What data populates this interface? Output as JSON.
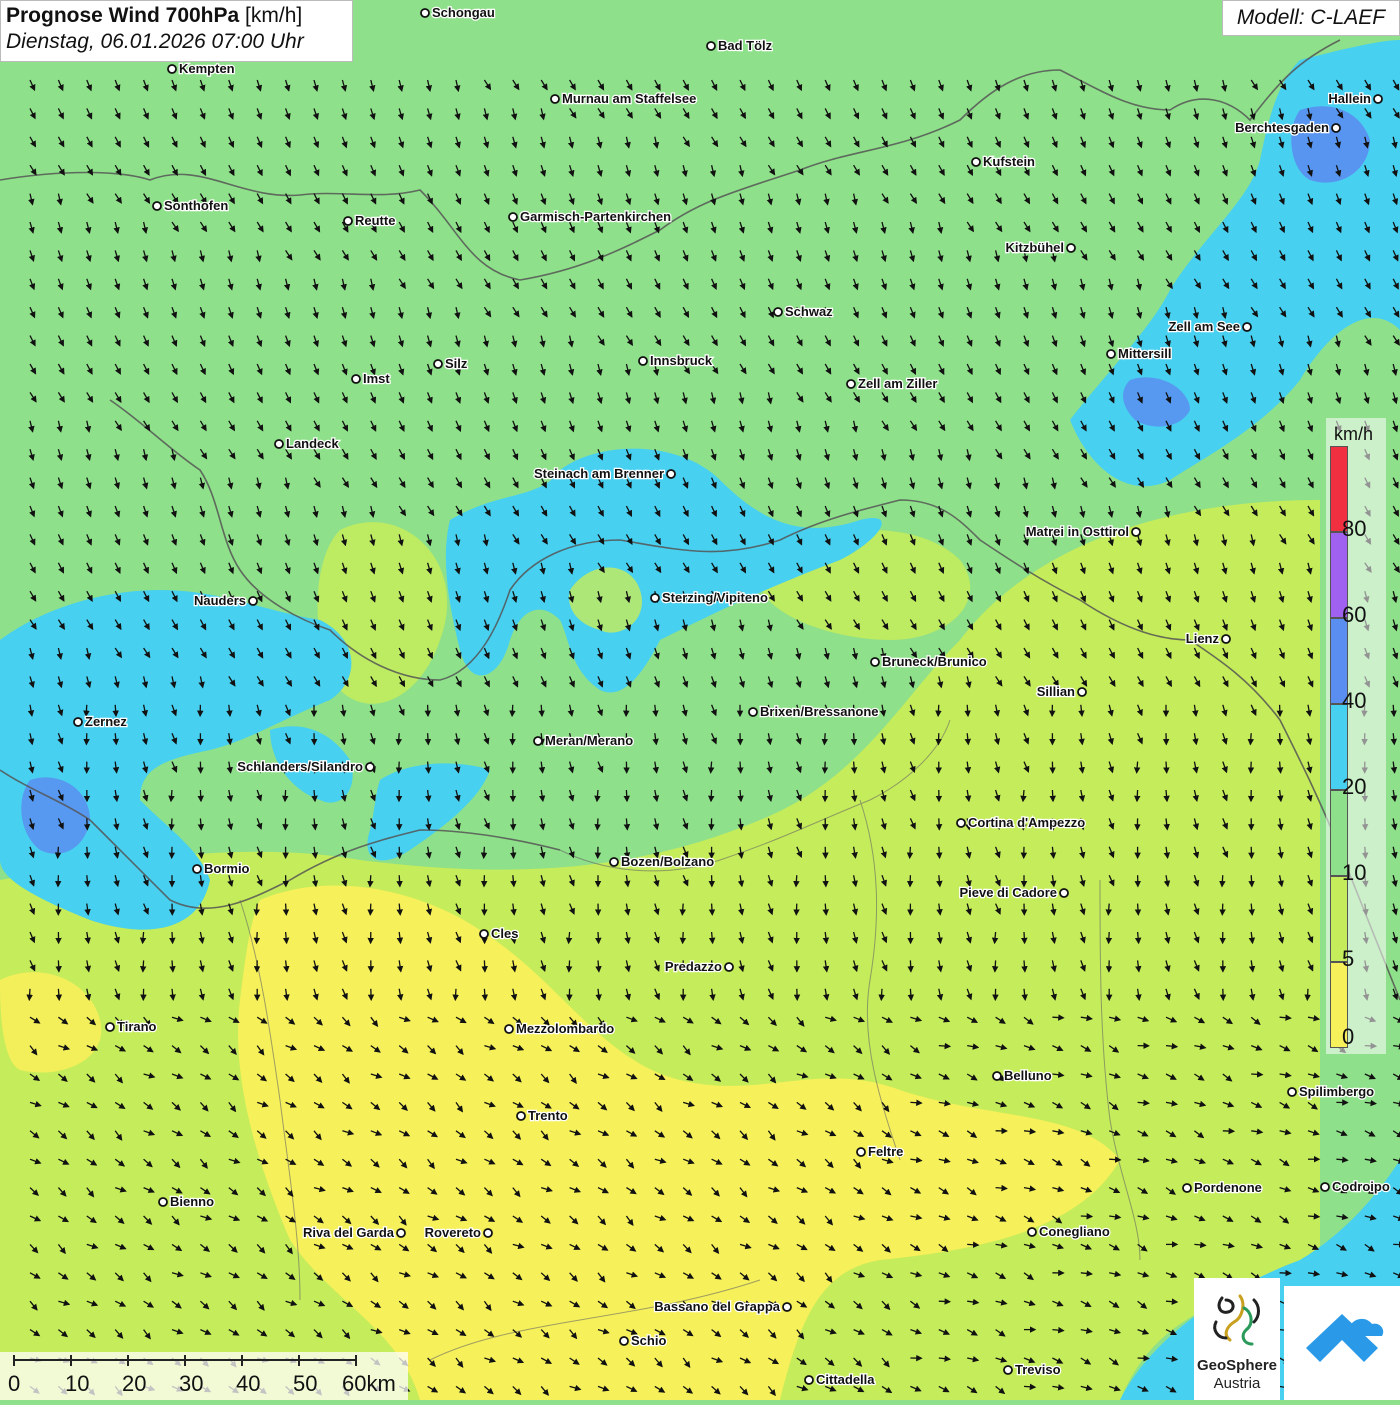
{
  "title": {
    "bold": "Prognose Wind 700hPa",
    "unit": "[km/h]",
    "datetime": "Dienstag, 06.01.2026 07:00 Uhr"
  },
  "model": "Modell: C-LAEF",
  "legend": {
    "unit": "km/h",
    "ticks": [
      "0",
      "5",
      "10",
      "20",
      "40",
      "60",
      "80"
    ],
    "colors": [
      "#f6f05a",
      "#c5ec5a",
      "#8fe08a",
      "#48d0f0",
      "#5a8ef0",
      "#a060f0",
      "#f03040"
    ]
  },
  "scale": {
    "labels": [
      "0",
      "10",
      "20",
      "30",
      "40",
      "50",
      "60km"
    ]
  },
  "logo": {
    "name": "GeoSphere",
    "sub": "Austria"
  },
  "icons": [
    "geosphere-logo-icon",
    "weather-app-icon"
  ],
  "cities": [
    {
      "name": "Schongau"
    },
    {
      "name": "Bad Tölz"
    },
    {
      "name": "Kempten"
    },
    {
      "name": "Murnau am Staffelsee"
    },
    {
      "name": "Hallein"
    },
    {
      "name": "Berchtesgaden"
    },
    {
      "name": "Kufstein"
    },
    {
      "name": "Sonthofen"
    },
    {
      "name": "Reutte"
    },
    {
      "name": "Garmisch-Partenkirchen"
    },
    {
      "name": "Kitzbühel"
    },
    {
      "name": "Schwaz"
    },
    {
      "name": "Zell am See"
    },
    {
      "name": "Mittersill"
    },
    {
      "name": "Imst"
    },
    {
      "name": "Silz"
    },
    {
      "name": "Innsbruck"
    },
    {
      "name": "Zell am Ziller"
    },
    {
      "name": "Landeck"
    },
    {
      "name": "Steinach am Brenner"
    },
    {
      "name": "Matrei in Osttirol"
    },
    {
      "name": "Nauders"
    },
    {
      "name": "Sterzing/Vipiteno"
    },
    {
      "name": "Lienz"
    },
    {
      "name": "Bruneck/Brunico"
    },
    {
      "name": "Sillian"
    },
    {
      "name": "Zernez"
    },
    {
      "name": "Brixen/Bressanone"
    },
    {
      "name": "Meran/Merano"
    },
    {
      "name": "Schlanders/Silandro"
    },
    {
      "name": "Cortina d'Ampezzo"
    },
    {
      "name": "Bozen/Bolzano"
    },
    {
      "name": "Bormio"
    },
    {
      "name": "Pieve di Cadore"
    },
    {
      "name": "Cles"
    },
    {
      "name": "Predazzo"
    },
    {
      "name": "Tirano"
    },
    {
      "name": "Mezzolombardo"
    },
    {
      "name": "Belluno"
    },
    {
      "name": "Spilimbergo"
    },
    {
      "name": "Trento"
    },
    {
      "name": "Feltre"
    },
    {
      "name": "Bienno"
    },
    {
      "name": "Pordenone"
    },
    {
      "name": "Codroipo"
    },
    {
      "name": "Riva del Garda"
    },
    {
      "name": "Rovereto"
    },
    {
      "name": "Conegliano"
    },
    {
      "name": "Bassano del Grappa"
    },
    {
      "name": "Schio"
    },
    {
      "name": "Treviso"
    },
    {
      "name": "Cittadella"
    }
  ]
}
